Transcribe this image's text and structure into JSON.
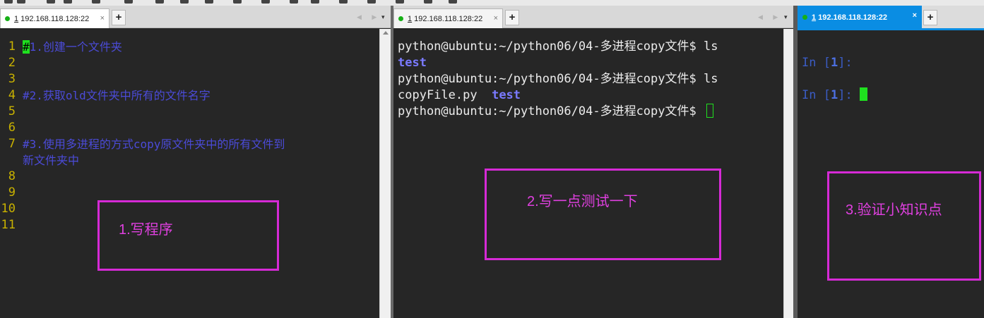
{
  "colors": {
    "editor_bg": "#262626",
    "line_number": "#c9b200",
    "comment_text": "#4b4bd8",
    "terminal_text": "#ececec",
    "terminal_dir": "#7a7aff",
    "cursor": "#1fe01f",
    "active_tab": "#0a8de3",
    "annotation": "#d62ad6"
  },
  "panes": [
    {
      "tab": {
        "number": "1",
        "title": "192.168.118.128:22",
        "close": "×",
        "status": "connected"
      },
      "plus": "+",
      "nav_arrows": "◀ ▶",
      "menu": "▾"
    },
    {
      "tab": {
        "number": "1",
        "title": "192.168.118.128:22",
        "close": "×",
        "status": "connected"
      },
      "plus": "+",
      "nav_arrows": "◀ ▶",
      "menu": "▾"
    },
    {
      "tab": {
        "number": "1",
        "title": "192.168.118.128:22",
        "close": "×",
        "status": "connected"
      },
      "plus": "+"
    }
  ],
  "editor": {
    "line_numbers": [
      "1",
      "2",
      "3",
      "4",
      "5",
      "6",
      "7",
      "",
      "8",
      "9",
      "10",
      "11"
    ],
    "first_char": "#",
    "line1_rest": "1.创建一个文件夹",
    "line4": "#2.获取old文件夹中所有的文件名字",
    "line7a": "#3.使用多进程的方式copy原文件夹中的所有文件到",
    "line7b": "新文件夹中"
  },
  "terminal": {
    "prompt": "python@ubuntu:~/python06/04-多进程copy文件$ ",
    "cmd1": "ls",
    "out1_dir": "test",
    "cmd2": "ls",
    "out2_file": "copyFile.py",
    "out2_dir": "test"
  },
  "ipython": {
    "in_prefix": "In [",
    "in_number": "1",
    "in_suffix": "]: "
  },
  "annotations": [
    {
      "label": "1.写程序"
    },
    {
      "label": "2.写一点测试一下"
    },
    {
      "label": "3.验证小知识点"
    }
  ]
}
